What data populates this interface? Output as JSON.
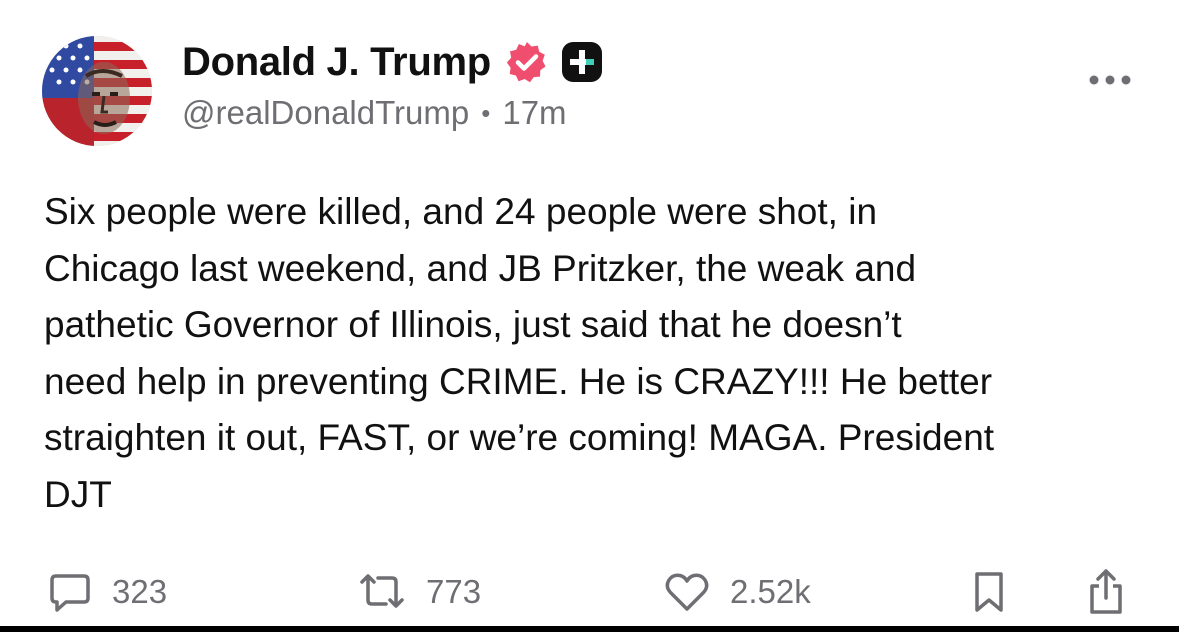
{
  "post": {
    "author": {
      "display_name": "Donald J. Trump",
      "handle": "@realDonaldTrump",
      "time_ago": "17m",
      "separator": "•",
      "verified_color": "#f04e6e",
      "badge_color": "#111111",
      "avatar_icon": "avatar-flag-portrait"
    },
    "text": "Six people were killed, and 24 people were shot, in\nChicago last weekend, and JB Pritzker, the weak and\npathetic Governor of Illinois, just said that he doesn’t\nneed help in preventing CRIME. He is CRAZY!!! He better\nstraighten it out, FAST, or we’re coming! MAGA. President\nDJT",
    "more_icon": "more-horizontal-icon",
    "actions": {
      "reply": {
        "icon": "reply-bubble-icon",
        "count": "323"
      },
      "retruth": {
        "icon": "retruth-arrows-icon",
        "count": "773"
      },
      "like": {
        "icon": "heart-icon",
        "count": "2.52k"
      },
      "bookmark": {
        "icon": "bookmark-icon"
      },
      "share": {
        "icon": "share-icon"
      }
    },
    "icon_color": "#6e6e73",
    "text_color": "#111111"
  }
}
